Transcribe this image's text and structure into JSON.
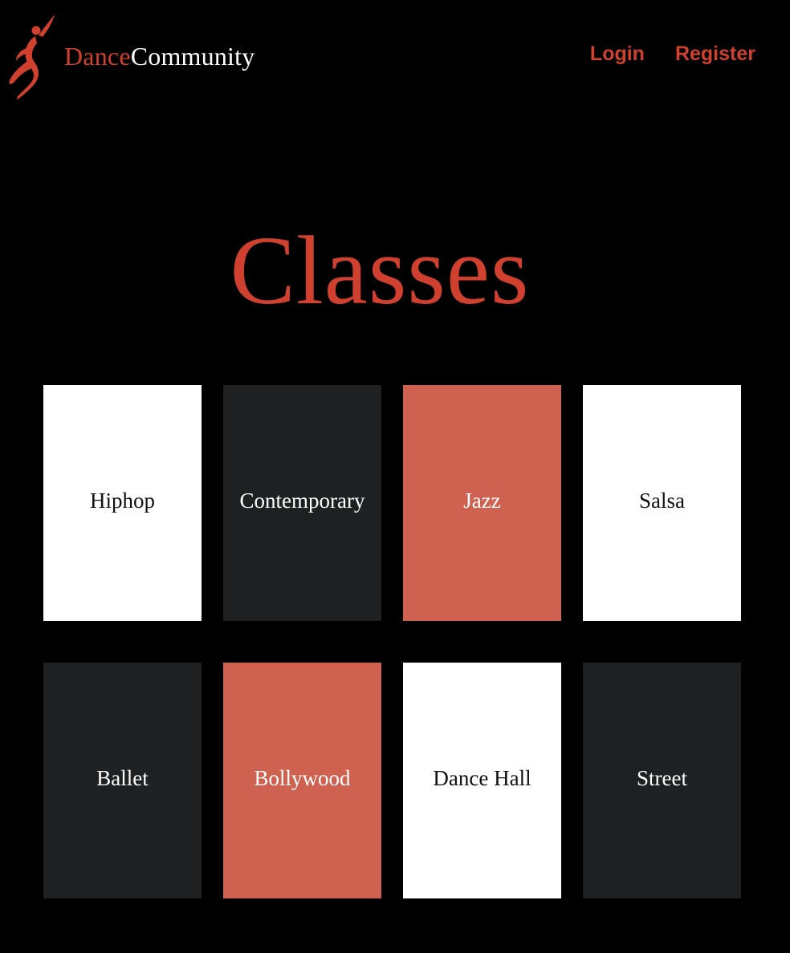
{
  "header": {
    "logo": {
      "icon": "dancer-figure-icon",
      "text_dance": "Dance",
      "text_community": "Community"
    },
    "nav": {
      "login_label": "Login",
      "register_label": "Register"
    }
  },
  "main": {
    "title": "Classes",
    "classes": [
      {
        "label": "Hiphop",
        "color": "#ffffff"
      },
      {
        "label": "Contemporary",
        "color": "#1e2022"
      },
      {
        "label": "Jazz",
        "color": "#cf6150"
      },
      {
        "label": "Salsa",
        "color": "#ffffff"
      },
      {
        "label": "Ballet",
        "color": "#1e2022"
      },
      {
        "label": "Bollywood",
        "color": "#cf6150"
      },
      {
        "label": "Dance Hall",
        "color": "#ffffff"
      },
      {
        "label": "Street",
        "color": "#1e2022"
      }
    ]
  },
  "theme": {
    "background": "#000000",
    "accent": "#d0402e",
    "card_white": "#ffffff",
    "card_dark": "#1e2022",
    "card_red": "#cf6150"
  }
}
